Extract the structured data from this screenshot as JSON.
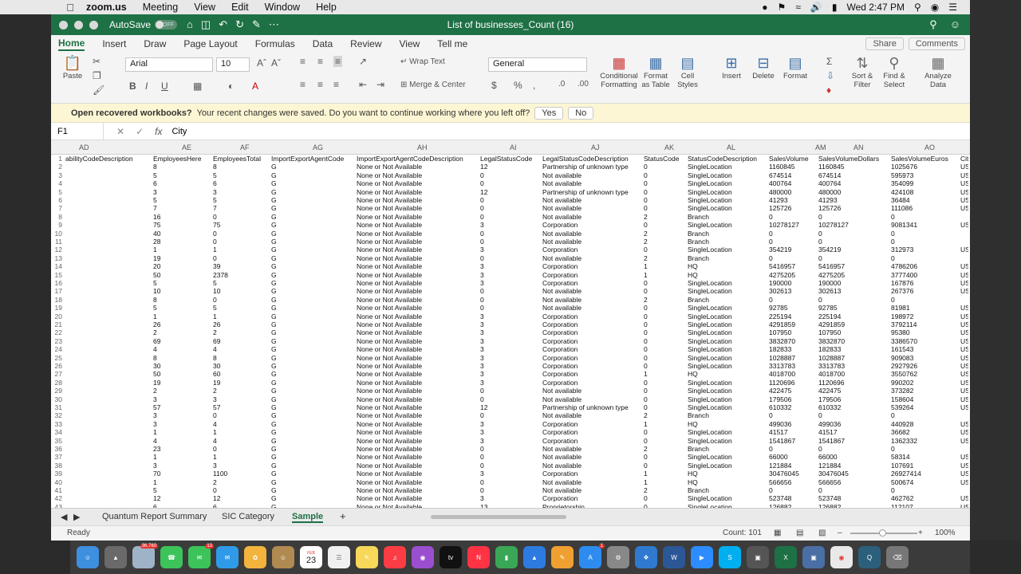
{
  "menubar": {
    "app": "zoom.us",
    "items": [
      "Meeting",
      "View",
      "Edit",
      "Window",
      "Help"
    ],
    "clock": "Wed 2:47 PM"
  },
  "titlebar": {
    "autosave_label": "AutoSave",
    "autosave_state": "OFF",
    "title": "List of businesses_Count (16)"
  },
  "tabs": [
    "Home",
    "Insert",
    "Draw",
    "Page Layout",
    "Formulas",
    "Data",
    "Review",
    "View",
    "Tell me"
  ],
  "share_label": "Share",
  "comments_label": "Comments",
  "ribbon": {
    "paste": "Paste",
    "font_name": "Arial",
    "font_size": "10",
    "wrap_text": "Wrap Text",
    "merge_center": "Merge & Center",
    "number_format": "General",
    "conditional_formatting": "Conditional Formatting",
    "format_as_table": "Format as Table",
    "cell_styles": "Cell Styles",
    "insert": "Insert",
    "delete": "Delete",
    "format": "Format",
    "sort_filter": "Sort & Filter",
    "find_select": "Find & Select",
    "analyze_data": "Analyze Data"
  },
  "message_bar": {
    "title": "Open recovered workbooks?",
    "text": "Your recent changes were saved. Do you want to continue working where you left off?",
    "yes": "Yes",
    "no": "No"
  },
  "formula_bar": {
    "name_box": "F1",
    "formula": "City"
  },
  "columns": [
    "AD",
    "AE",
    "AF",
    "AG",
    "AH",
    "AI",
    "AJ",
    "AK",
    "AL",
    "AM",
    "AN",
    "AO"
  ],
  "rows": [
    {
      "n": "1",
      "c": [
        "abilityCodeDescription",
        "EmployeesHere",
        "EmployeesTotal",
        "ImportExportAgentCode",
        "ImportExportAgentCodeDescription",
        "LegalStatusCode",
        "LegalStatusCodeDescription",
        "StatusCode",
        "StatusCodeDescription",
        "SalesVolume",
        "SalesVolumeDollars",
        "SalesVolumeEuros",
        "Cit"
      ]
    },
    {
      "n": "2",
      "c": [
        "",
        "8",
        "8",
        "G",
        "None or Not Available",
        "12",
        "Partnership of unknown type",
        "0",
        "SingleLocation",
        "1160845",
        "1160845",
        "1025676",
        "US"
      ]
    },
    {
      "n": "3",
      "c": [
        "",
        "5",
        "5",
        "G",
        "None or Not Available",
        "0",
        "Not available",
        "0",
        "SingleLocation",
        "674514",
        "674514",
        "595973",
        "US"
      ]
    },
    {
      "n": "4",
      "c": [
        "",
        "6",
        "6",
        "G",
        "None or Not Available",
        "0",
        "Not available",
        "0",
        "SingleLocation",
        "400764",
        "400764",
        "354099",
        "US"
      ]
    },
    {
      "n": "5",
      "c": [
        "",
        "3",
        "3",
        "G",
        "None or Not Available",
        "12",
        "Partnership of unknown type",
        "0",
        "SingleLocation",
        "480000",
        "480000",
        "424108",
        "US"
      ]
    },
    {
      "n": "6",
      "c": [
        "",
        "5",
        "5",
        "G",
        "None or Not Available",
        "0",
        "Not available",
        "0",
        "SingleLocation",
        "41293",
        "41293",
        "36484",
        "US"
      ]
    },
    {
      "n": "7",
      "c": [
        "",
        "7",
        "7",
        "G",
        "None or Not Available",
        "0",
        "Not available",
        "0",
        "SingleLocation",
        "125726",
        "125726",
        "111086",
        "US"
      ]
    },
    {
      "n": "8",
      "c": [
        "",
        "16",
        "0",
        "G",
        "None or Not Available",
        "0",
        "Not available",
        "2",
        "Branch",
        "0",
        "0",
        "0",
        ""
      ]
    },
    {
      "n": "9",
      "c": [
        "",
        "75",
        "75",
        "G",
        "None or Not Available",
        "3",
        "Corporation",
        "0",
        "SingleLocation",
        "10278127",
        "10278127",
        "9081341",
        "US"
      ]
    },
    {
      "n": "10",
      "c": [
        "",
        "40",
        "0",
        "G",
        "None or Not Available",
        "0",
        "Not available",
        "2",
        "Branch",
        "0",
        "0",
        "0",
        ""
      ]
    },
    {
      "n": "11",
      "c": [
        "",
        "28",
        "0",
        "G",
        "None or Not Available",
        "0",
        "Not available",
        "2",
        "Branch",
        "0",
        "0",
        "0",
        ""
      ]
    },
    {
      "n": "12",
      "c": [
        "",
        "1",
        "1",
        "G",
        "None or Not Available",
        "3",
        "Corporation",
        "0",
        "SingleLocation",
        "354219",
        "354219",
        "312973",
        "US"
      ]
    },
    {
      "n": "13",
      "c": [
        "",
        "19",
        "0",
        "G",
        "None or Not Available",
        "0",
        "Not available",
        "2",
        "Branch",
        "0",
        "0",
        "0",
        ""
      ]
    },
    {
      "n": "14",
      "c": [
        "",
        "20",
        "39",
        "G",
        "None or Not Available",
        "3",
        "Corporation",
        "1",
        "HQ",
        "5416957",
        "5416957",
        "4786206",
        "US"
      ]
    },
    {
      "n": "15",
      "c": [
        "",
        "50",
        "2378",
        "G",
        "None or Not Available",
        "3",
        "Corporation",
        "1",
        "HQ",
        "4275205",
        "4275205",
        "3777400",
        "US"
      ]
    },
    {
      "n": "16",
      "c": [
        "",
        "5",
        "5",
        "G",
        "None or Not Available",
        "3",
        "Corporation",
        "0",
        "SingleLocation",
        "190000",
        "190000",
        "167876",
        "US"
      ]
    },
    {
      "n": "17",
      "c": [
        "",
        "10",
        "10",
        "G",
        "None or Not Available",
        "0",
        "Not available",
        "0",
        "SingleLocation",
        "302613",
        "302613",
        "267376",
        "US"
      ]
    },
    {
      "n": "18",
      "c": [
        "",
        "8",
        "0",
        "G",
        "None or Not Available",
        "0",
        "Not available",
        "2",
        "Branch",
        "0",
        "0",
        "0",
        ""
      ]
    },
    {
      "n": "19",
      "c": [
        "",
        "5",
        "5",
        "G",
        "None or Not Available",
        "0",
        "Not available",
        "0",
        "SingleLocation",
        "92785",
        "92785",
        "81981",
        "US"
      ]
    },
    {
      "n": "20",
      "c": [
        "",
        "1",
        "1",
        "G",
        "None or Not Available",
        "3",
        "Corporation",
        "0",
        "SingleLocation",
        "225194",
        "225194",
        "198972",
        "US"
      ]
    },
    {
      "n": "21",
      "c": [
        "",
        "26",
        "26",
        "G",
        "None or Not Available",
        "3",
        "Corporation",
        "0",
        "SingleLocation",
        "4291859",
        "4291859",
        "3792114",
        "US"
      ]
    },
    {
      "n": "22",
      "c": [
        "",
        "2",
        "2",
        "G",
        "None or Not Available",
        "3",
        "Corporation",
        "0",
        "SingleLocation",
        "107950",
        "107950",
        "95380",
        "US"
      ]
    },
    {
      "n": "23",
      "c": [
        "",
        "69",
        "69",
        "G",
        "None or Not Available",
        "3",
        "Corporation",
        "0",
        "SingleLocation",
        "3832870",
        "3832870",
        "3386570",
        "US"
      ]
    },
    {
      "n": "24",
      "c": [
        "",
        "4",
        "4",
        "G",
        "None or Not Available",
        "3",
        "Corporation",
        "0",
        "SingleLocation",
        "182833",
        "182833",
        "161543",
        "US"
      ]
    },
    {
      "n": "25",
      "c": [
        "",
        "8",
        "8",
        "G",
        "None or Not Available",
        "3",
        "Corporation",
        "0",
        "SingleLocation",
        "1028887",
        "1028887",
        "909083",
        "US"
      ]
    },
    {
      "n": "26",
      "c": [
        "",
        "30",
        "30",
        "G",
        "None or Not Available",
        "3",
        "Corporation",
        "0",
        "SingleLocation",
        "3313783",
        "3313783",
        "2927926",
        "US"
      ]
    },
    {
      "n": "27",
      "c": [
        "",
        "50",
        "60",
        "G",
        "None or Not Available",
        "3",
        "Corporation",
        "1",
        "HQ",
        "4018700",
        "4018700",
        "3550762",
        "US"
      ]
    },
    {
      "n": "28",
      "c": [
        "",
        "19",
        "19",
        "G",
        "None or Not Available",
        "3",
        "Corporation",
        "0",
        "SingleLocation",
        "1120696",
        "1120696",
        "990202",
        "US"
      ]
    },
    {
      "n": "29",
      "c": [
        "",
        "2",
        "2",
        "G",
        "None or Not Available",
        "0",
        "Not available",
        "0",
        "SingleLocation",
        "422475",
        "422475",
        "373282",
        "US"
      ]
    },
    {
      "n": "30",
      "c": [
        "",
        "3",
        "3",
        "G",
        "None or Not Available",
        "0",
        "Not available",
        "0",
        "SingleLocation",
        "179506",
        "179506",
        "158604",
        "US"
      ]
    },
    {
      "n": "31",
      "c": [
        "",
        "57",
        "57",
        "G",
        "None or Not Available",
        "12",
        "Partnership of unknown type",
        "0",
        "SingleLocation",
        "610332",
        "610332",
        "539264",
        "US"
      ]
    },
    {
      "n": "32",
      "c": [
        "",
        "3",
        "0",
        "G",
        "None or Not Available",
        "0",
        "Not available",
        "2",
        "Branch",
        "0",
        "0",
        "0",
        ""
      ]
    },
    {
      "n": "33",
      "c": [
        "",
        "3",
        "4",
        "G",
        "None or Not Available",
        "3",
        "Corporation",
        "1",
        "HQ",
        "499036",
        "499036",
        "440928",
        "US"
      ]
    },
    {
      "n": "34",
      "c": [
        "",
        "1",
        "1",
        "G",
        "None or Not Available",
        "3",
        "Corporation",
        "0",
        "SingleLocation",
        "41517",
        "41517",
        "36682",
        "US"
      ]
    },
    {
      "n": "35",
      "c": [
        "",
        "4",
        "4",
        "G",
        "None or Not Available",
        "3",
        "Corporation",
        "0",
        "SingleLocation",
        "1541867",
        "1541867",
        "1362332",
        "US"
      ]
    },
    {
      "n": "36",
      "c": [
        "",
        "23",
        "0",
        "G",
        "None or Not Available",
        "0",
        "Not available",
        "2",
        "Branch",
        "0",
        "0",
        "0",
        ""
      ]
    },
    {
      "n": "37",
      "c": [
        "",
        "1",
        "1",
        "G",
        "None or Not Available",
        "0",
        "Not available",
        "0",
        "SingleLocation",
        "66000",
        "66000",
        "58314",
        "US"
      ]
    },
    {
      "n": "38",
      "c": [
        "",
        "3",
        "3",
        "G",
        "None or Not Available",
        "0",
        "Not available",
        "0",
        "SingleLocation",
        "121884",
        "121884",
        "107691",
        "US"
      ]
    },
    {
      "n": "39",
      "c": [
        "",
        "70",
        "1100",
        "G",
        "None or Not Available",
        "3",
        "Corporation",
        "1",
        "HQ",
        "30476045",
        "30476045",
        "26927414",
        "US"
      ]
    },
    {
      "n": "40",
      "c": [
        "",
        "1",
        "2",
        "G",
        "None or Not Available",
        "0",
        "Not available",
        "1",
        "HQ",
        "566656",
        "566656",
        "500674",
        "US"
      ]
    },
    {
      "n": "41",
      "c": [
        "",
        "5",
        "0",
        "G",
        "None or Not Available",
        "0",
        "Not available",
        "2",
        "Branch",
        "0",
        "0",
        "0",
        ""
      ]
    },
    {
      "n": "42",
      "c": [
        "",
        "12",
        "12",
        "G",
        "None or Not Available",
        "3",
        "Corporation",
        "0",
        "SingleLocation",
        "523748",
        "523748",
        "462762",
        "US"
      ]
    },
    {
      "n": "43",
      "c": [
        "",
        "6",
        "6",
        "G",
        "None or Not Available",
        "13",
        "Proprietorship",
        "0",
        "SingleLocation",
        "126882",
        "126882",
        "112107",
        "US"
      ]
    }
  ],
  "sheet_tabs": [
    "Quantum Report Summary",
    "SIC Category",
    "Sample"
  ],
  "active_sheet": "Sample",
  "status": {
    "ready": "Ready",
    "count": "Count: 101",
    "zoom": "100%"
  },
  "dock_badges": {
    "photos": "36,760",
    "messages": "13",
    "appstore": "1"
  },
  "dock_calendar": {
    "month": "FEB",
    "day": "23"
  }
}
